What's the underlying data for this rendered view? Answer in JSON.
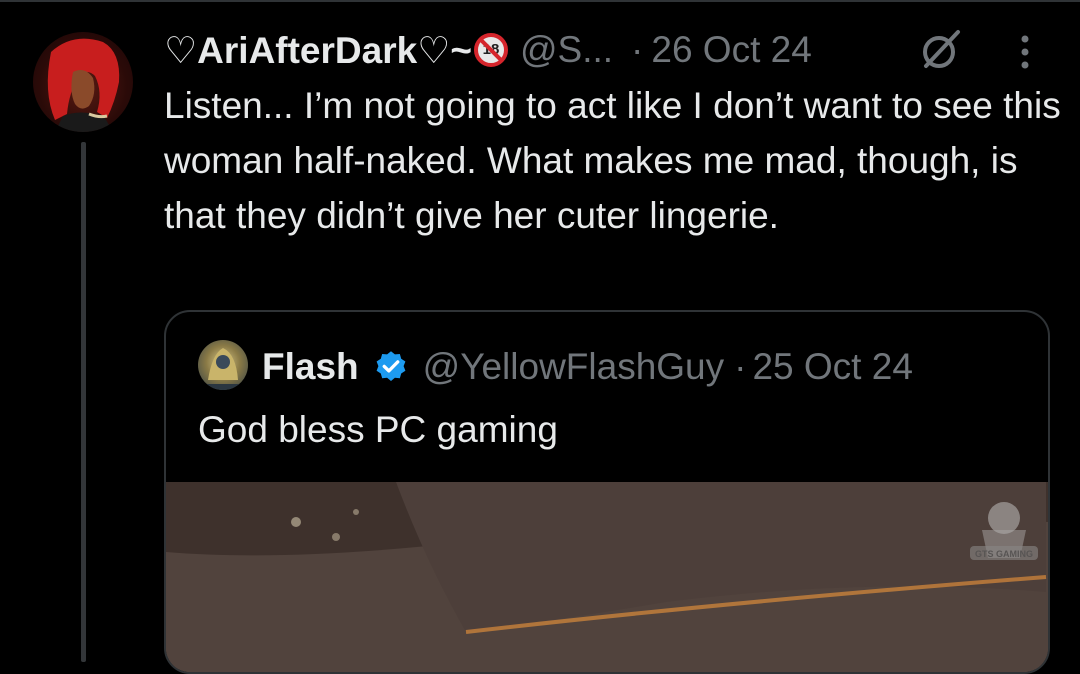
{
  "tweet": {
    "display_name": "♡AriAfterDark♡~",
    "nsfw_badge": "18",
    "handle": "@S...",
    "dot": "·",
    "date": "26 Oct 24",
    "text": "Listen... I’m not going to act like I don’t want to see this woman half-naked. What makes me mad, though, is that they didn’t give her cuter lingerie.",
    "icons": [
      "avatar",
      "grok-icon",
      "more-icon"
    ]
  },
  "quote": {
    "display_name": "Flash",
    "handle": "@YellowFlashGuy",
    "dot": "·",
    "date": "25 Oct 24",
    "text": "God bless PC gaming",
    "verified": true,
    "watermark_text": "GTS GAMING"
  },
  "colors": {
    "background": "#000000",
    "text": "#e7e9ea",
    "muted": "#71767b",
    "border": "#2f3336",
    "verified": "#1d9bf0",
    "nsfw_red": "#d5252c"
  }
}
